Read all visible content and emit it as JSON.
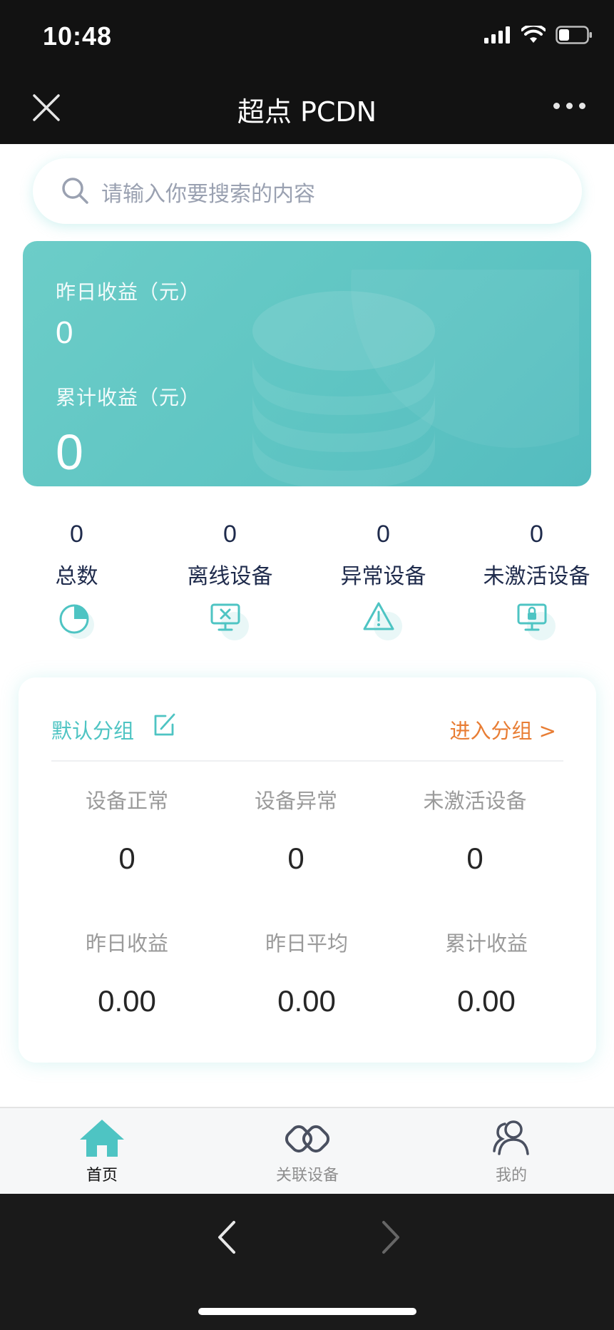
{
  "status_bar": {
    "time": "10:48"
  },
  "nav": {
    "title": "超点 PCDN"
  },
  "search": {
    "placeholder": "请输入你要搜索的内容"
  },
  "earnings": {
    "yesterday_label": "昨日收益（元）",
    "yesterday_value": "0",
    "total_label": "累计收益（元）",
    "total_value": "0"
  },
  "stats": [
    {
      "value": "0",
      "label": "总数",
      "icon": "pie-chart-icon"
    },
    {
      "value": "0",
      "label": "离线设备",
      "icon": "offline-monitor-icon"
    },
    {
      "value": "0",
      "label": "异常设备",
      "icon": "warning-triangle-icon"
    },
    {
      "value": "0",
      "label": "未激活设备",
      "icon": "locked-monitor-icon"
    }
  ],
  "group": {
    "title": "默认分组",
    "enter_label": "进入分组 >",
    "metrics": [
      {
        "label": "设备正常",
        "value": "0"
      },
      {
        "label": "设备异常",
        "value": "0"
      },
      {
        "label": "未激活设备",
        "value": "0"
      },
      {
        "label": "昨日收益",
        "value": "0.00"
      },
      {
        "label": "昨日平均",
        "value": "0.00"
      },
      {
        "label": "累计收益",
        "value": "0.00"
      }
    ]
  },
  "tabs": [
    {
      "label": "首页",
      "active": true,
      "icon": "home-icon"
    },
    {
      "label": "关联设备",
      "active": false,
      "icon": "link-icon"
    },
    {
      "label": "我的",
      "active": false,
      "icon": "users-icon"
    }
  ],
  "colors": {
    "accent": "#5fc5c3",
    "orange": "#e87d34",
    "dark_bar": "#121212",
    "text_dark": "#1f2b4c"
  }
}
